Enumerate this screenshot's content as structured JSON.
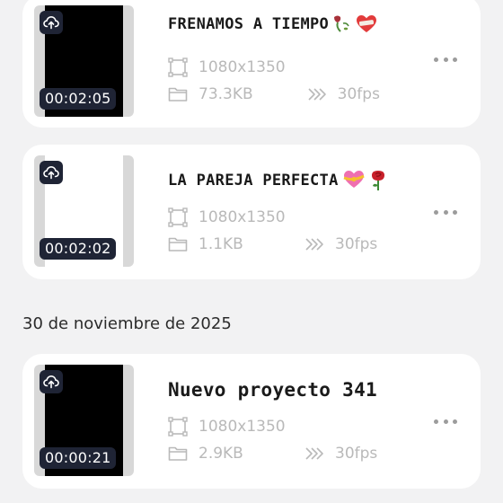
{
  "projects": [
    {
      "title": "FRENAMOS A TIEMPO",
      "emojis": [
        "wilted-rose-emoji",
        "mending-heart-emoji"
      ],
      "duration": "00:02:05",
      "resolution": "1080x1350",
      "size": "73.3KB",
      "fps": "30fps",
      "thumbnail": "black"
    },
    {
      "title": "LA PAREJA PERFECTA",
      "emojis": [
        "heart-with-ribbon-emoji",
        "rose-emoji"
      ],
      "duration": "00:02:02",
      "resolution": "1080x1350",
      "size": "1.1KB",
      "fps": "30fps",
      "thumbnail": "white"
    }
  ],
  "date_section": {
    "label": "30 de noviembre de 2025",
    "projects": [
      {
        "title": "Nuevo proyecto 341",
        "duration": "00:00:21",
        "resolution": "1080x1350",
        "size": "2.9KB",
        "fps": "30fps",
        "thumbnail": "black"
      }
    ]
  },
  "colors": {
    "background": "#f2f2f3",
    "card": "#ffffff",
    "badge": "#1f2435",
    "meta_text": "#b9b9b9"
  }
}
